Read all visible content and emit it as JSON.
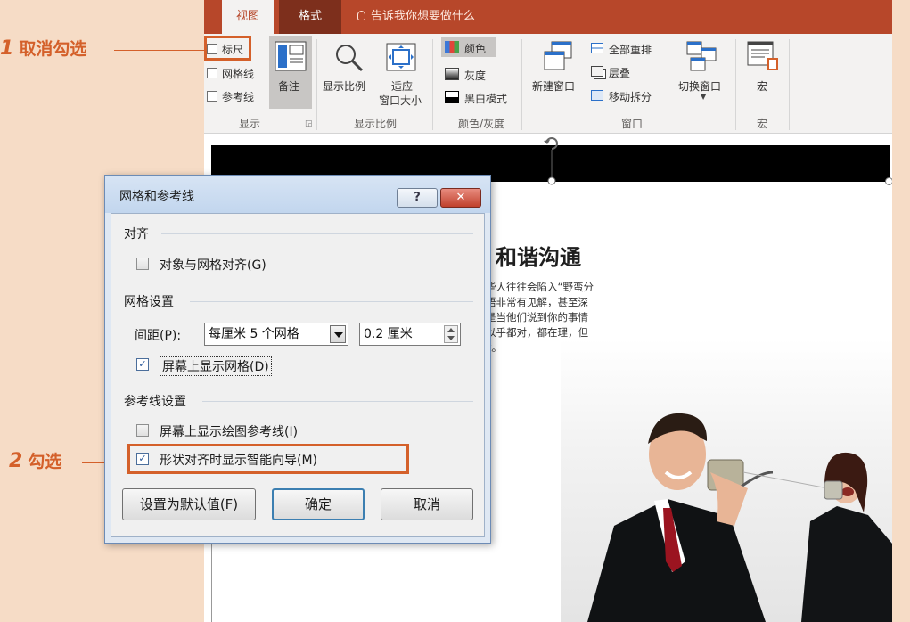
{
  "callouts": {
    "first": {
      "num": "1",
      "text": "取消勾选"
    },
    "second": {
      "num": "2",
      "text": "勾选"
    }
  },
  "ribbon": {
    "tabs": [
      {
        "label": "视图"
      },
      {
        "label": "格式"
      }
    ],
    "tell_me": "告诉我你想要做什么",
    "show": {
      "ruler": "标尺",
      "gridlines": "网格线",
      "guides": "参考线",
      "notes": "备注",
      "group": "显示"
    },
    "zoom": {
      "zoom": "显示比例",
      "fit_line1": "适应",
      "fit_line2": "窗口大小",
      "group": "显示比例"
    },
    "color": {
      "color": "颜色",
      "gray": "灰度",
      "bw": "黑白模式",
      "group": "颜色/灰度"
    },
    "window": {
      "new_window": "新建窗口",
      "arrange_all": "全部重排",
      "cascade": "层叠",
      "move_split": "移动拆分",
      "switch": "切换窗口",
      "group": "窗口"
    },
    "macros": {
      "macros": "宏",
      "group": "宏"
    }
  },
  "slide": {
    "title": "和谐沟通",
    "body": [
      "些人往往会陷入“野蛮分",
      "语非常有见解，甚至深",
      "是当他们说到你的事情",
      "以乎都对，都在理，但",
      "k。"
    ]
  },
  "dialog": {
    "title": "网格和参考线",
    "help": "?",
    "close": "✕",
    "align_section": "对齐",
    "snap_to_grid": "对象与网格对齐(G)",
    "grid_section": "网格设置",
    "spacing_label": "间距(P):",
    "spacing_value": "每厘米 5 个网格",
    "spacing_number": "0.2 厘米",
    "show_grid": "屏幕上显示网格(D)",
    "guides_section": "参考线设置",
    "show_guides": "屏幕上显示绘图参考线(I)",
    "smart_guides": "形状对齐时显示智能向导(M)",
    "set_default": "设置为默认值(F)",
    "ok": "确定",
    "cancel": "取消"
  },
  "colors": {
    "accent": "#d4602a",
    "ribbon": "#b7472a"
  }
}
